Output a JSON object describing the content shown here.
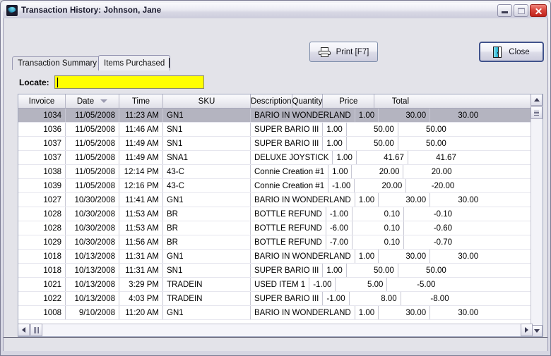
{
  "window": {
    "title": "Transaction History: Johnson, Jane",
    "app_icon": "app-swoosh-icon",
    "buttons": {
      "minimize": "minimize-icon",
      "maximize": "maximize-icon",
      "close": "close-icon"
    }
  },
  "toolbar": {
    "print_label": "Print [F7]",
    "print_icon": "printer-icon",
    "close_label": "Close",
    "close_icon": "door-exit-icon"
  },
  "tabs": [
    {
      "label": "Transaction Summary",
      "active": false
    },
    {
      "label": "Items Purchased",
      "active": true
    }
  ],
  "locate": {
    "label": "Locate:",
    "value": "",
    "placeholder": "",
    "field_color": "#ffff00"
  },
  "grid": {
    "sort_column": "Date",
    "sort_direction": "descending",
    "columns": [
      {
        "label": "Invoice",
        "key": "invoice",
        "align": "r"
      },
      {
        "label": "Date",
        "key": "date",
        "align": "r"
      },
      {
        "label": "Time",
        "key": "time",
        "align": "r"
      },
      {
        "label": "SKU",
        "key": "sku",
        "align": "l"
      },
      {
        "label": "Description",
        "key": "description",
        "align": "l"
      },
      {
        "label": "Quantity",
        "key": "quantity",
        "align": "r"
      },
      {
        "label": "Price",
        "key": "price",
        "align": "r"
      },
      {
        "label": "Total",
        "key": "total",
        "align": "r"
      }
    ],
    "rows": [
      {
        "invoice": "1034",
        "date": "11/05/2008",
        "time": "11:23 AM",
        "sku": "GN1",
        "description": "BARIO IN WONDERLAND",
        "quantity": "1.00",
        "price": "30.00",
        "total": "30.00",
        "selected": true
      },
      {
        "invoice": "1036",
        "date": "11/05/2008",
        "time": "11:46 AM",
        "sku": "SN1",
        "description": "SUPER BARIO III",
        "quantity": "1.00",
        "price": "50.00",
        "total": "50.00",
        "selected": false
      },
      {
        "invoice": "1037",
        "date": "11/05/2008",
        "time": "11:49 AM",
        "sku": "SN1",
        "description": "SUPER BARIO III",
        "quantity": "1.00",
        "price": "50.00",
        "total": "50.00",
        "selected": false
      },
      {
        "invoice": "1037",
        "date": "11/05/2008",
        "time": "11:49 AM",
        "sku": "SNA1",
        "description": "DELUXE JOYSTICK",
        "quantity": "1.00",
        "price": "41.67",
        "total": "41.67",
        "selected": false
      },
      {
        "invoice": "1038",
        "date": "11/05/2008",
        "time": "12:14 PM",
        "sku": "43-C",
        "description": "Connie Creation #1",
        "quantity": "1.00",
        "price": "20.00",
        "total": "20.00",
        "selected": false
      },
      {
        "invoice": "1039",
        "date": "11/05/2008",
        "time": "12:16 PM",
        "sku": "43-C",
        "description": "Connie Creation #1",
        "quantity": "-1.00",
        "price": "20.00",
        "total": "-20.00",
        "selected": false
      },
      {
        "invoice": "1027",
        "date": "10/30/2008",
        "time": "11:41 AM",
        "sku": "GN1",
        "description": "BARIO IN WONDERLAND",
        "quantity": "1.00",
        "price": "30.00",
        "total": "30.00",
        "selected": false
      },
      {
        "invoice": "1028",
        "date": "10/30/2008",
        "time": "11:53 AM",
        "sku": "BR",
        "description": "BOTTLE REFUND",
        "quantity": "-1.00",
        "price": "0.10",
        "total": "-0.10",
        "selected": false
      },
      {
        "invoice": "1028",
        "date": "10/30/2008",
        "time": "11:53 AM",
        "sku": "BR",
        "description": "BOTTLE REFUND",
        "quantity": "-6.00",
        "price": "0.10",
        "total": "-0.60",
        "selected": false
      },
      {
        "invoice": "1029",
        "date": "10/30/2008",
        "time": "11:56 AM",
        "sku": "BR",
        "description": "BOTTLE REFUND",
        "quantity": "-7.00",
        "price": "0.10",
        "total": "-0.70",
        "selected": false
      },
      {
        "invoice": "1018",
        "date": "10/13/2008",
        "time": "11:31 AM",
        "sku": "GN1",
        "description": "BARIO IN WONDERLAND",
        "quantity": "1.00",
        "price": "30.00",
        "total": "30.00",
        "selected": false
      },
      {
        "invoice": "1018",
        "date": "10/13/2008",
        "time": "11:31 AM",
        "sku": "SN1",
        "description": "SUPER BARIO III",
        "quantity": "1.00",
        "price": "50.00",
        "total": "50.00",
        "selected": false
      },
      {
        "invoice": "1021",
        "date": "10/13/2008",
        "time": "3:29 PM",
        "sku": "TRADEIN",
        "description": "USED ITEM 1",
        "quantity": "-1.00",
        "price": "5.00",
        "total": "-5.00",
        "selected": false
      },
      {
        "invoice": "1022",
        "date": "10/13/2008",
        "time": "4:03 PM",
        "sku": "TRADEIN",
        "description": "SUPER BARIO III",
        "quantity": "-1.00",
        "price": "8.00",
        "total": "-8.00",
        "selected": false
      },
      {
        "invoice": "1008",
        "date": "9/10/2008",
        "time": "11:20 AM",
        "sku": "GN1",
        "description": "BARIO IN WONDERLAND",
        "quantity": "1.00",
        "price": "30.00",
        "total": "30.00",
        "selected": false
      }
    ]
  },
  "scrollbars": {
    "vertical": {
      "up": "chevron-up-icon",
      "down": "chevron-down-icon",
      "thumb": "scroll-thumb"
    },
    "horizontal": {
      "left": "chevron-left-icon",
      "right": "chevron-right-icon",
      "thumb": "scroll-thumb"
    }
  }
}
